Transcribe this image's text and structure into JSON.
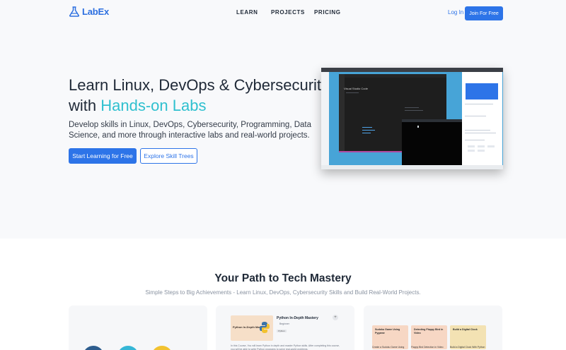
{
  "header": {
    "logo_text": "LabEx",
    "nav": [
      "LEARN",
      "PROJECTS",
      "PRICING"
    ],
    "login_label": "Log In",
    "join_label": "Join For Free"
  },
  "hero": {
    "title_line1": "Learn Linux, DevOps & Cybersecurity",
    "title_prefix": "with ",
    "title_highlight": "Hands-on Labs",
    "description": "Develop skills in Linux, DevOps, Cybersecurity, Programming, Data Science, and more through interactive labs and real-world projects.",
    "cta_primary": "Start Learning for Free",
    "cta_secondary": "Explore Skill Trees",
    "screenshot": {
      "editor_title": "Visual Studio Code"
    }
  },
  "path_section": {
    "title": "Your Path to Tech Mastery",
    "subtitle": "Simple Steps to Big Achievements - Learn Linux, DevOps, Cybersecurity Skills and Build Real-World Projects."
  },
  "course_card": {
    "thumb_title": "Python In-Depth Mastery",
    "title": "Python In-Depth Mastery",
    "level": "Beginner",
    "tag": "Python",
    "description": "In this Course, You will learn Python in depth and master Python skills. After completing this course, you will be able to write Python programs to solve real-world problems."
  },
  "project_cards": [
    {
      "label": "Sudoku Game Using Pygame",
      "caption": "Create a Sudoku Game Using",
      "color": "#f7d7c4"
    },
    {
      "label": "Detecting Flappy Bird in Video",
      "caption": "Flappy Bird Detection in Video",
      "color": "#f7d7c4"
    },
    {
      "label": "Build a Digital Clock",
      "caption": "Build a Digital Clock With Python",
      "color": "#f3e2b3"
    }
  ],
  "colors": {
    "brand_blue": "#2d74e8",
    "highlight_teal": "#2fc0cf",
    "hero_bg": "#f8f9fb",
    "circle_1": "#2d5d8e",
    "circle_2": "#35b6d6",
    "circle_3": "#f2c230"
  }
}
